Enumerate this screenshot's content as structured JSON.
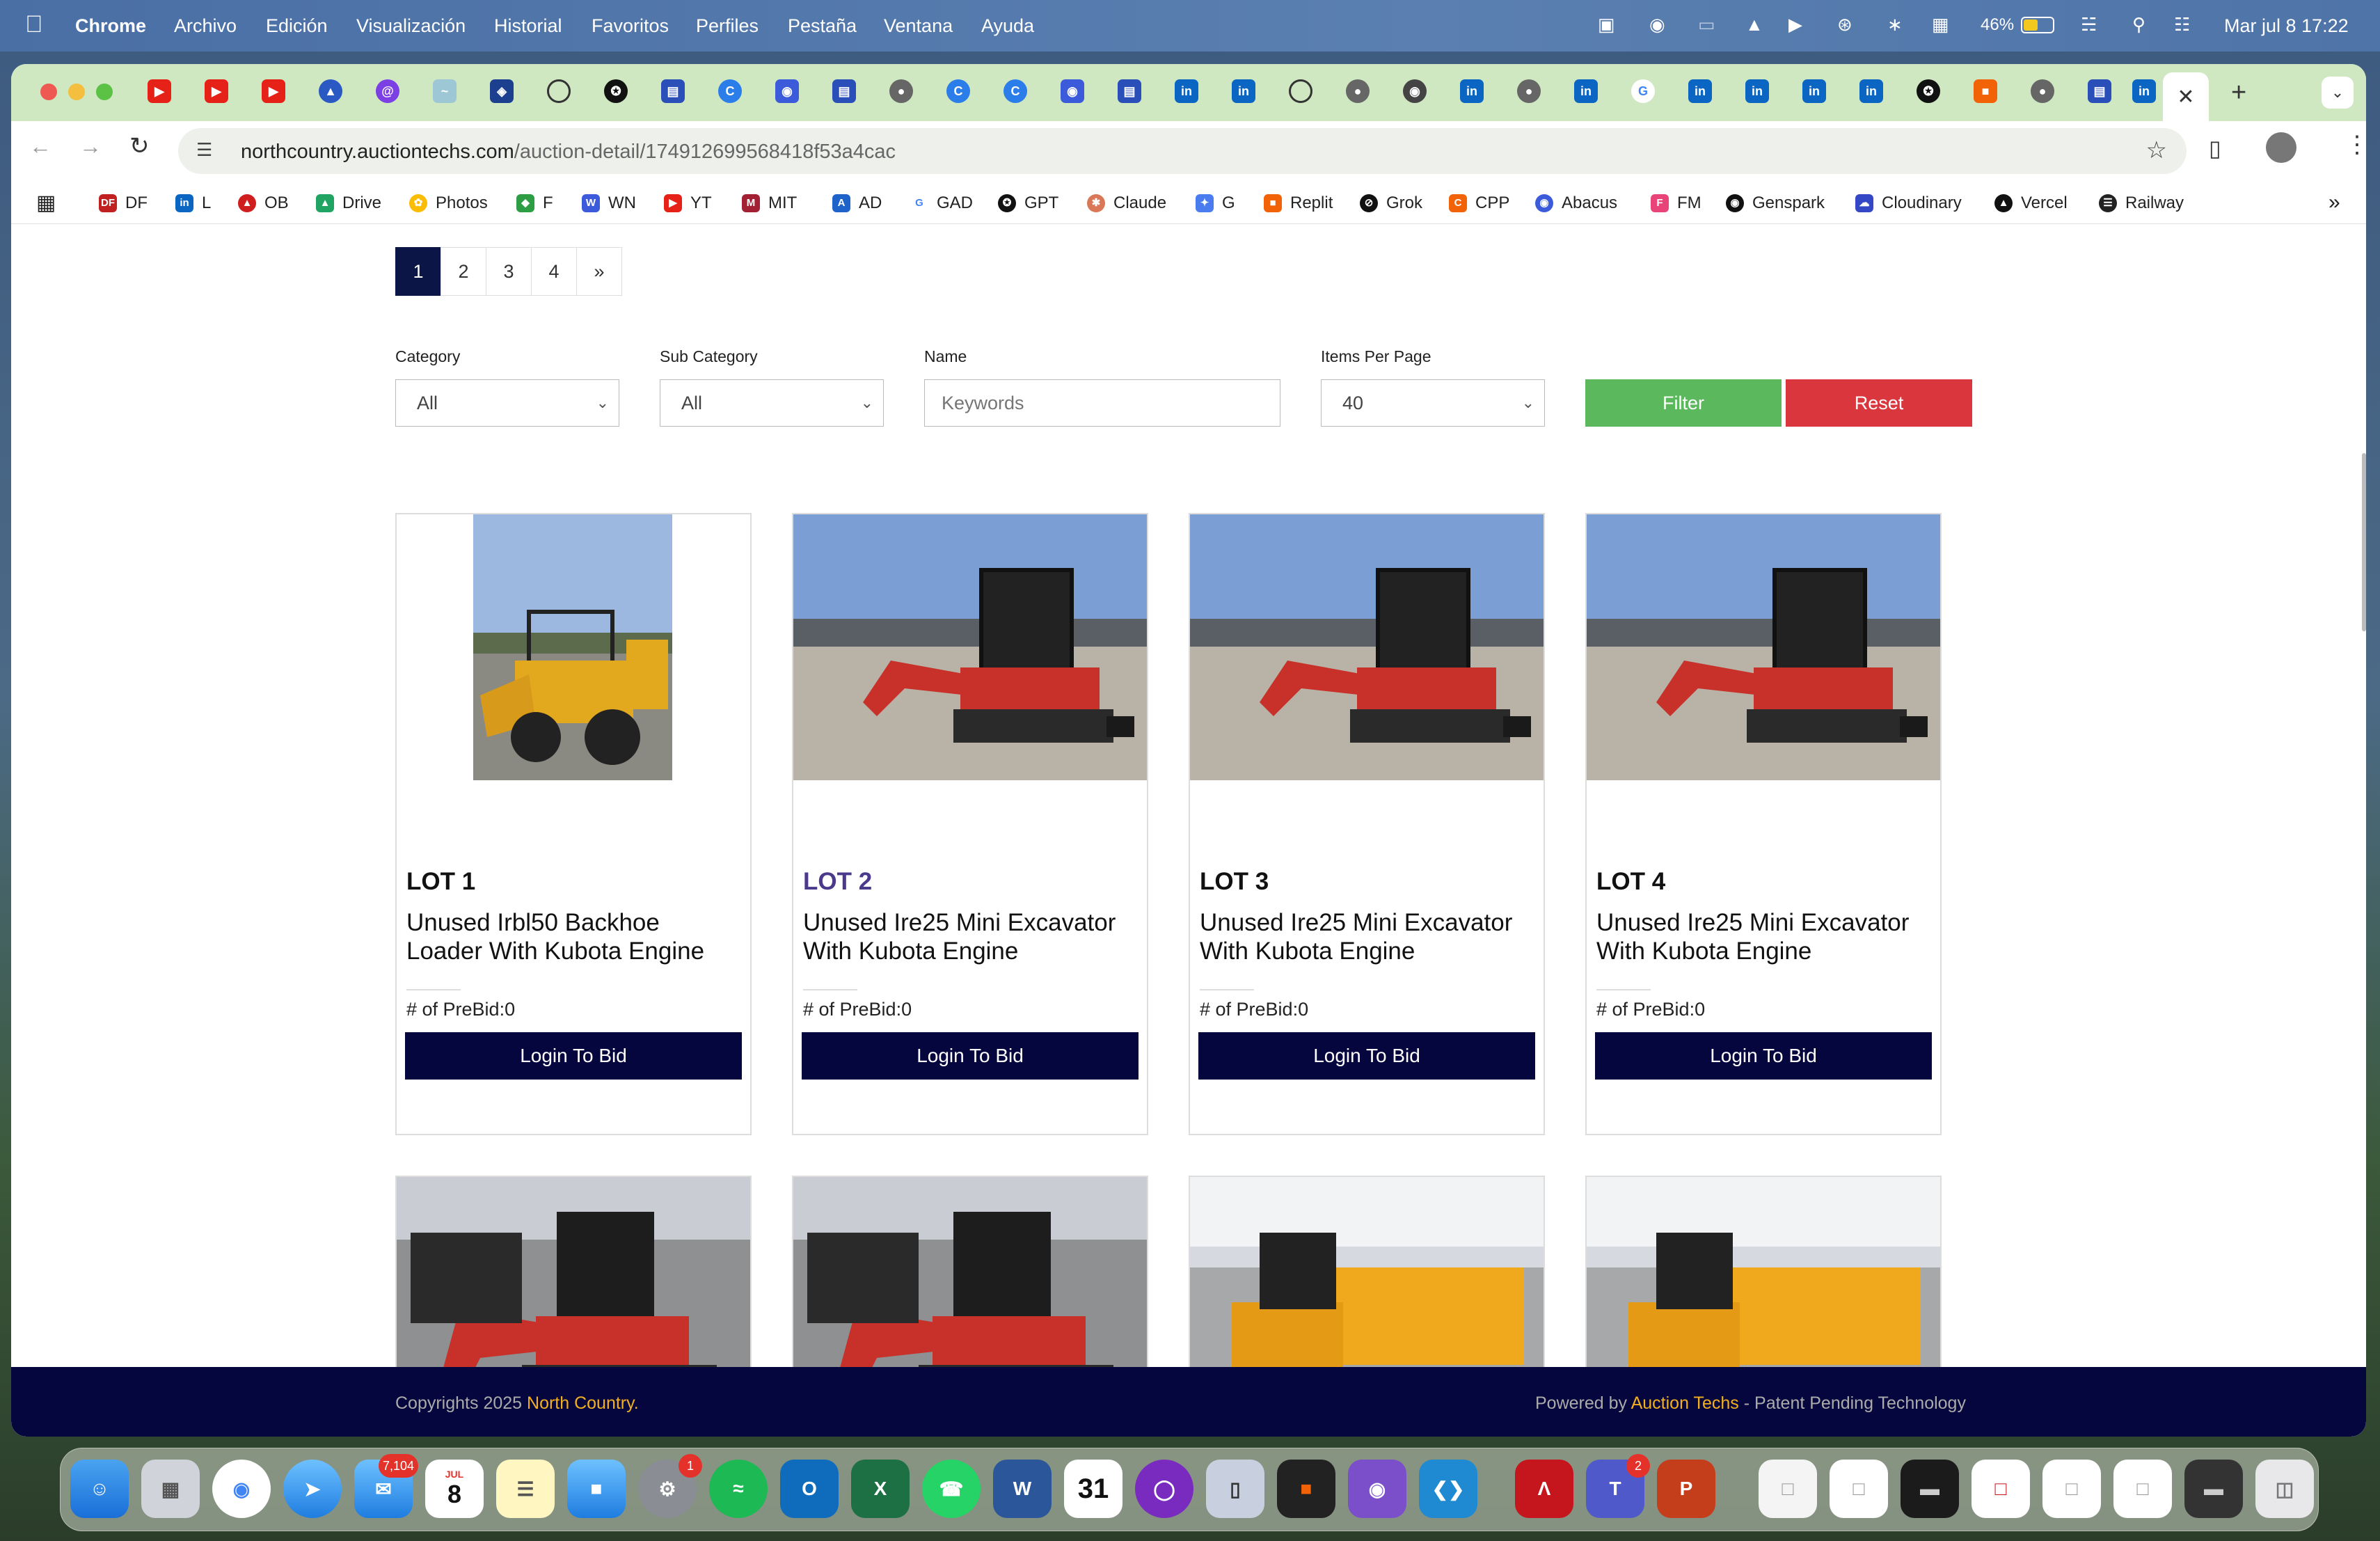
{
  "menubar": {
    "app": "Chrome",
    "items": [
      "Archivo",
      "Edición",
      "Visualización",
      "Historial",
      "Favoritos",
      "Perfiles",
      "Pestaña",
      "Ventana",
      "Ayuda"
    ],
    "battery": "46%",
    "datetime": "Mar jul 8  17:22"
  },
  "browser": {
    "url_host": "northcountry.auctiontechs.com",
    "url_path": "/auction-detail/174912699568418f53a4cac",
    "bookmarks": [
      "DF",
      "L",
      "OB",
      "Drive",
      "Photos",
      "F",
      "WN",
      "YT",
      "MIT",
      "AD",
      "GAD",
      "GPT",
      "Claude",
      "G",
      "Replit",
      "Grok",
      "CPP",
      "Abacus",
      "FM",
      "Genspark",
      "Cloudinary",
      "Vercel",
      "Railway"
    ],
    "overflow": "»"
  },
  "pagination": [
    "1",
    "2",
    "3",
    "4",
    "»"
  ],
  "filters": {
    "category_label": "Category",
    "category_value": "All",
    "subcategory_label": "Sub Category",
    "subcategory_value": "All",
    "name_label": "Name",
    "name_placeholder": "Keywords",
    "items_label": "Items Per Page",
    "items_value": "40",
    "filter_button": "Filter",
    "reset_button": "Reset"
  },
  "lots": [
    {
      "lot": "LOT 1",
      "title": "Unused Irbl50 Backhoe Loader With Kubota Engine",
      "prebid": "# of PreBid:0",
      "button": "Login To Bid"
    },
    {
      "lot": "LOT 2",
      "title": "Unused Ire25 Mini Excavator With Kubota Engine",
      "prebid": "# of PreBid:0",
      "button": "Login To Bid"
    },
    {
      "lot": "LOT 3",
      "title": "Unused Ire25 Mini Excavator With Kubota Engine",
      "prebid": "# of PreBid:0",
      "button": "Login To Bid"
    },
    {
      "lot": "LOT 4",
      "title": "Unused Ire25 Mini Excavator With Kubota Engine",
      "prebid": "# of PreBid:0",
      "button": "Login To Bid"
    }
  ],
  "footer": {
    "copyright_prefix": "Copyrights 2025 ",
    "company": "North Country.",
    "powered_prefix": "Powered by ",
    "powered_link": "Auction Techs",
    "powered_suffix": " - Patent Pending Technology"
  },
  "dock": {
    "mail_badge": "7,104",
    "calendar_month": "JUL",
    "calendar_day": "8",
    "settings_badge": "1",
    "teams_badge": "2",
    "calendar2_day": "31"
  },
  "colors": {
    "navy": "#06063f",
    "filter_green": "#5cb85c",
    "reset_red": "#d9363e",
    "footer_gold": "#f2b01e",
    "lot2_purple": "#4b3a8c"
  }
}
